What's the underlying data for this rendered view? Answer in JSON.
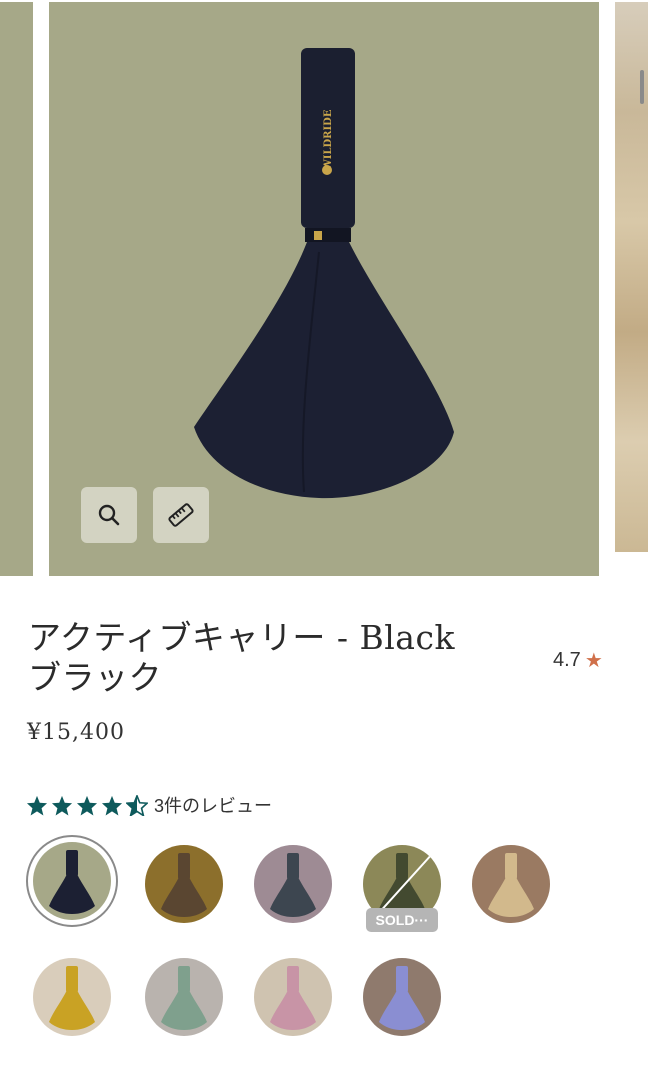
{
  "product": {
    "title_line1": "アクティブキャリー - Black",
    "title_line2": "ブラック",
    "price": "¥15,400",
    "rating": "4.7",
    "brand_on_image": "WILDRIDE"
  },
  "reviews": {
    "stars_value": 4.5,
    "stars_max": 5,
    "label": "3件のレビュー"
  },
  "gallery": {
    "tools": [
      {
        "name": "zoom",
        "icon": "magnifier-icon"
      },
      {
        "name": "size",
        "icon": "ruler-icon"
      }
    ]
  },
  "variants": [
    {
      "color": "Black",
      "bg": "#a6a888",
      "sling": "#1c2033",
      "selected": true
    },
    {
      "color": "Brown",
      "bg": "#8c6f2c",
      "sling": "#5a4631"
    },
    {
      "color": "Grey",
      "bg": "#9e8b94",
      "sling": "#3d4650"
    },
    {
      "color": "Olive",
      "bg": "#8c8858",
      "sling": "#434a30",
      "sold_out": true,
      "badge": "SOLD···"
    },
    {
      "color": "Sand",
      "bg": "#9a7a62",
      "sling": "#d2b98c"
    },
    {
      "color": "Mustard",
      "bg": "#d9cdbb",
      "sling": "#c9a224"
    },
    {
      "color": "Sage",
      "bg": "#b9b3ae",
      "sling": "#7fa08d"
    },
    {
      "color": "Pink",
      "bg": "#cfc3b0",
      "sling": "#c894a6"
    },
    {
      "color": "Lavender",
      "bg": "#8f7a6d",
      "sling": "#8a8ed2"
    }
  ],
  "colors": {
    "accent_star": "#d0704a",
    "review_star": "#0e5a5c"
  }
}
